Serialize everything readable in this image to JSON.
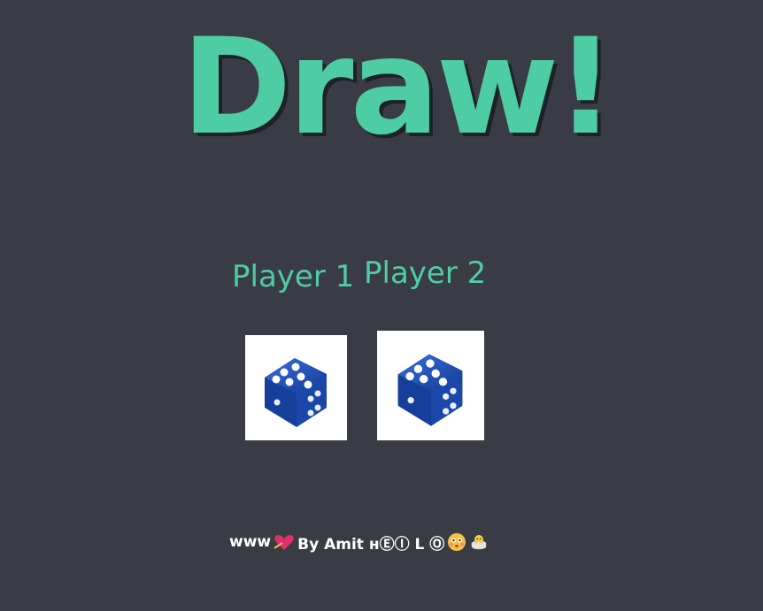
{
  "game": {
    "title": "Draw!",
    "players": [
      {
        "label": "Player 1",
        "dice_value": 6,
        "dice_color": "#1f4fb8"
      },
      {
        "label": "Player 2",
        "dice_value": 6,
        "dice_color": "#1f4fb8"
      }
    ]
  },
  "footer": {
    "prefix": "www",
    "credit": "By Amit ʜⒺⒾ L Ⓞ",
    "icons": [
      "arrow-heart-icon",
      "flushed-face-icon",
      "hatching-chick-icon"
    ]
  },
  "colors": {
    "background": "#393b45",
    "accent": "#4ecca3",
    "dice_face": "#ffffff"
  }
}
